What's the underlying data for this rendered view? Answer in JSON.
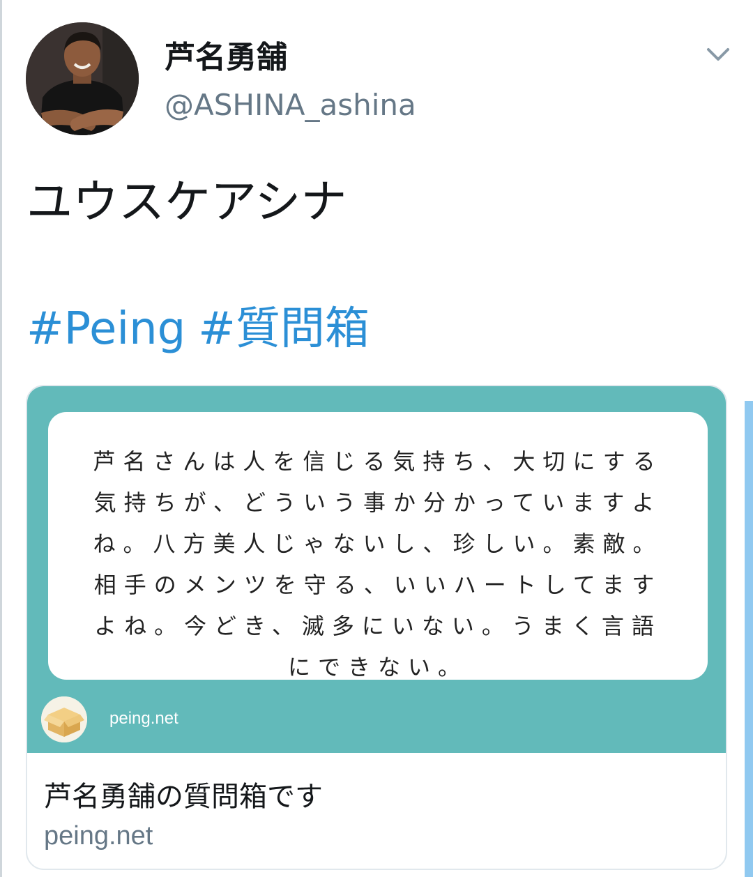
{
  "author": {
    "display_name": "芦名勇舗",
    "handle": "@ASHINA_ashina"
  },
  "tweet": {
    "text": "ユウスケアシナ",
    "hashtags": [
      "#Peing",
      "#質問箱"
    ]
  },
  "card": {
    "question": "芦名さんは人を信じる気持ち、大切にする気持ちが、どういう事か分かっていますよね。八方美人じゃないし、珍しい。素敵。相手のメンツを守る、いいハートしてますよね。今どき、滅多にいない。うまく言語にできない。",
    "site_label": "peing.net",
    "title": "芦名勇舗の質問箱です",
    "domain": "peing.net"
  },
  "icons": {
    "menu": "chevron-down-icon",
    "site_logo": "cardboard-box-icon"
  },
  "colors": {
    "hashtag": "#2b8fd6",
    "card_bg": "#62baba",
    "secondary_text": "#657786",
    "scrollbar": "#90c9f0"
  }
}
